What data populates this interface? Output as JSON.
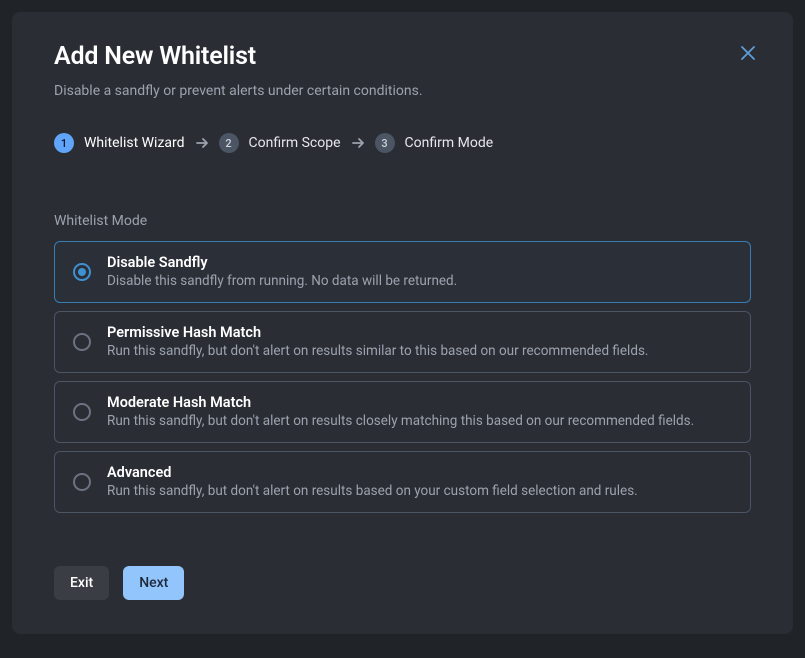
{
  "dialog": {
    "title": "Add New Whitelist",
    "subtitle": "Disable a sandfly or prevent alerts under certain conditions."
  },
  "stepper": {
    "steps": [
      {
        "num": "1",
        "label": "Whitelist Wizard",
        "active": true
      },
      {
        "num": "2",
        "label": "Confirm Scope",
        "active": false
      },
      {
        "num": "3",
        "label": "Confirm Mode",
        "active": false
      }
    ]
  },
  "section": {
    "label": "Whitelist Mode",
    "options": [
      {
        "title": "Disable Sandfly",
        "desc": "Disable this sandfly from running. No data will be returned.",
        "selected": true
      },
      {
        "title": "Permissive Hash Match",
        "desc": "Run this sandfly, but don't alert on results similar to this based on our recommended fields.",
        "selected": false
      },
      {
        "title": "Moderate Hash Match",
        "desc": "Run this sandfly, but don't alert on results closely matching this based on our recommended fields.",
        "selected": false
      },
      {
        "title": "Advanced",
        "desc": "Run this sandfly, but don't alert on results based on your custom field selection and rules.",
        "selected": false
      }
    ]
  },
  "footer": {
    "exit_label": "Exit",
    "next_label": "Next"
  }
}
